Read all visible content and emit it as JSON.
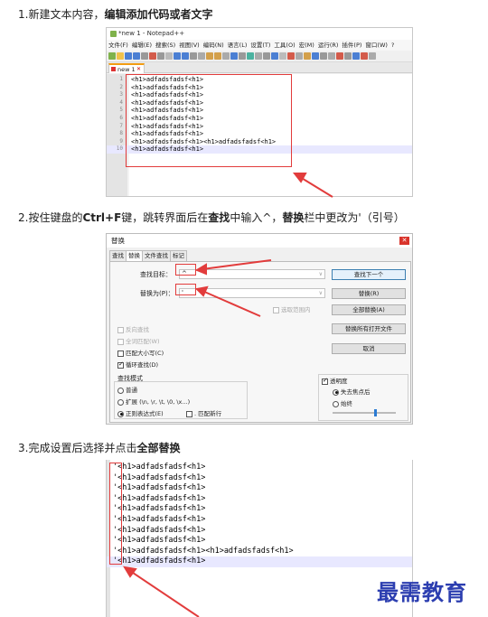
{
  "steps": {
    "step1": {
      "pre": "1.新建文本内容，",
      "bold": "编辑添加代码或者文字"
    },
    "step2": {
      "pre": "2.按住键盘的",
      "key": "Ctrl+F",
      "mid1": "键，跳转界面后在",
      "find": "查找",
      "mid2": "中输入^，",
      "replace": "替换",
      "post": "栏中更改为'（引号）"
    },
    "step3": {
      "pre": "3.完成设置后选择并点击",
      "bold": "全部替换"
    }
  },
  "notepad": {
    "title": "*new 1 - Notepad++",
    "menu": [
      "文件(F)",
      "编辑(E)",
      "搜索(S)",
      "视图(V)",
      "编码(N)",
      "语言(L)",
      "设置(T)",
      "工具(O)",
      "宏(M)",
      "运行(R)",
      "插件(P)",
      "窗口(W)",
      "?"
    ],
    "tab": "new 1",
    "tab_close": "✕",
    "lines": [
      {
        "n": "1",
        "t": "<h1>adfadsfadsf<h1>"
      },
      {
        "n": "2",
        "t": "<h1>adfadsfadsf<h1>"
      },
      {
        "n": "3",
        "t": "<h1>adfadsfadsf<h1>"
      },
      {
        "n": "4",
        "t": "<h1>adfadsfadsf<h1>"
      },
      {
        "n": "5",
        "t": "<h1>adfadsfadsf<h1>"
      },
      {
        "n": "6",
        "t": "<h1>adfadsfadsf<h1>"
      },
      {
        "n": "7",
        "t": "<h1>adfadsfadsf<h1>"
      },
      {
        "n": "8",
        "t": "<h1>adfadsfadsf<h1>"
      },
      {
        "n": "9",
        "t": "<h1>adfadsfadsf<h1><h1>adfadsfadsf<h1>"
      },
      {
        "n": "10",
        "t": "<h1>adfadsfadsf<h1>"
      }
    ]
  },
  "dialog": {
    "title": "替换",
    "close": "✕",
    "tabs": [
      "查找",
      "替换",
      "文件查找",
      "标记"
    ],
    "find_label": "查找目标：",
    "find_value": "^",
    "replace_label": "替换为(P)：",
    "replace_value": "'",
    "in_selection": "选取范围内",
    "buttons": {
      "find_next": "查找下一个",
      "replace": "替换(R)",
      "replace_all": "全部替换(A)",
      "replace_all_open": "替换所有打开文件",
      "cancel": "取消"
    },
    "checks": {
      "backward": "反向查找",
      "whole_word": "全词匹配(W)",
      "match_case": "匹配大小写(C)",
      "wrap": "循环查找(D)"
    },
    "mode_title": "查找模式",
    "modes": {
      "normal": "普通",
      "extended": "扩展 (\\n, \\r, \\t, \\0, \\x...)",
      "regex": "正则表达式(E)",
      "dot_newline": ". 匹配新行"
    },
    "transparency": "透明度",
    "trans_opts": {
      "lose_focus": "失去焦点后",
      "always": "始终"
    }
  },
  "result": {
    "lines": [
      "'<h1>adfadsfadsf<h1>",
      "'<h1>adfadsfadsf<h1>",
      "'<h1>adfadsfadsf<h1>",
      "'<h1>adfadsfadsf<h1>",
      "'<h1>adfadsfadsf<h1>",
      "'<h1>adfadsfadsf<h1>",
      "'<h1>adfadsfadsf<h1>",
      "'<h1>adfadsfadsf<h1>",
      "'<h1>adfadsfadsf<h1><h1>adfadsfadsf<h1>",
      "'<h1>adfadsfadsf<h1>"
    ]
  },
  "watermark": "最需教育",
  "colors": {
    "highlight_red": "#e23c3c",
    "watermark_blue": "#2c3eb0",
    "current_line": "#e8e8ff"
  }
}
